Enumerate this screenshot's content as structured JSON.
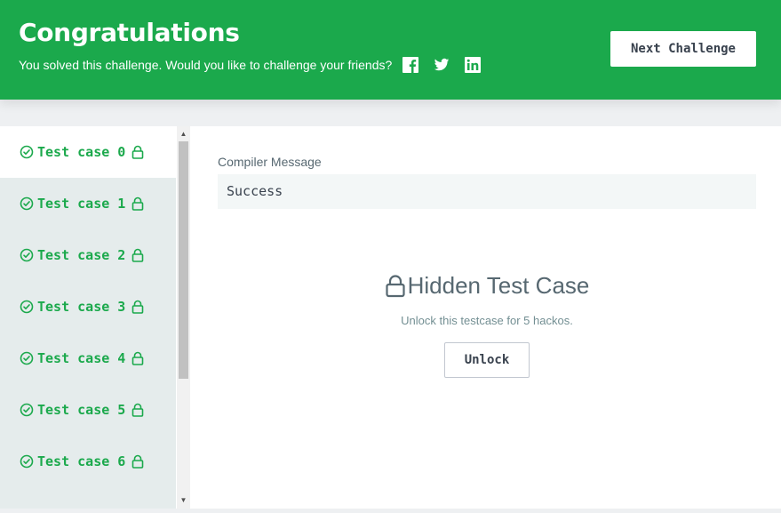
{
  "banner": {
    "title": "Congratulations",
    "message": "You solved this challenge. Would you like to challenge your friends?",
    "next_button": "Next Challenge",
    "share_icons": [
      "facebook-icon",
      "twitter-icon",
      "linkedin-icon"
    ]
  },
  "test_cases": {
    "active_index": 0,
    "items": [
      {
        "label": "Test case 0",
        "passed": true,
        "locked": true
      },
      {
        "label": "Test case 1",
        "passed": true,
        "locked": true
      },
      {
        "label": "Test case 2",
        "passed": true,
        "locked": true
      },
      {
        "label": "Test case 3",
        "passed": true,
        "locked": true
      },
      {
        "label": "Test case 4",
        "passed": true,
        "locked": true
      },
      {
        "label": "Test case 5",
        "passed": true,
        "locked": true
      },
      {
        "label": "Test case 6",
        "passed": true,
        "locked": true
      }
    ]
  },
  "compiler": {
    "label": "Compiler Message",
    "message": "Success"
  },
  "hidden": {
    "title": "Hidden Test Case",
    "subtitle": "Unlock this testcase for 5 hackos.",
    "unlock_button": "Unlock"
  },
  "colors": {
    "brand_green": "#1ba94c",
    "text_dark": "#39424e"
  }
}
